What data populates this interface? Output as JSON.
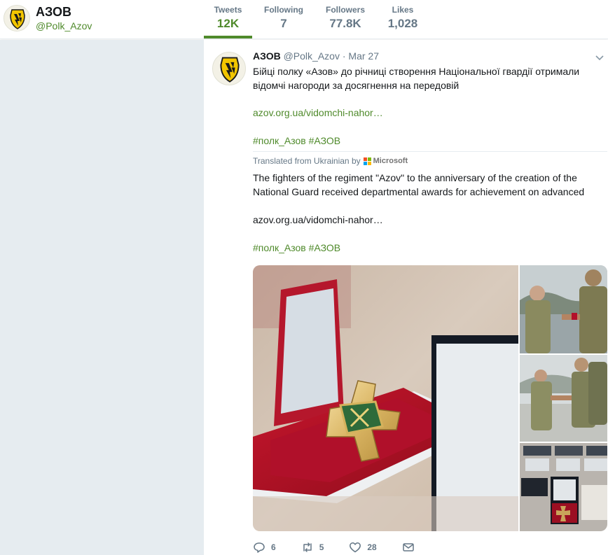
{
  "profile": {
    "name": "АЗОВ",
    "handle": "@Polk_Azov",
    "stats": [
      {
        "label": "Tweets",
        "value": "12K"
      },
      {
        "label": "Following",
        "value": "7"
      },
      {
        "label": "Followers",
        "value": "77.8K"
      },
      {
        "label": "Likes",
        "value": "1,028"
      }
    ]
  },
  "tweet": {
    "name": "АЗОВ",
    "handle": "@Polk_Azov",
    "separator": "·",
    "date": "Mar 27",
    "text_original": "Бійці полку «Азов» до річниці створення Національної гвардії отримали відомчі нагороди за досягнення на передовій",
    "link_original": "azov.org.ua/vidomchi-nahor…",
    "hashtags_original": "#полк_Азов #АЗОВ",
    "translated_label": "Translated from Ukrainian by",
    "translator": "Microsoft",
    "text_translated": "The fighters of the regiment \"Azov\" to the anniversary of the creation of the National Guard received departmental awards for achievement on advanced",
    "link_translated": "azov.org.ua/vidomchi-nahor…",
    "hashtags_translated": "#полк_Азов #АЗОВ",
    "actions": {
      "replies": "6",
      "retweets": "5",
      "likes": "28"
    }
  },
  "icons": [
    "chevron-down-icon",
    "reply-icon",
    "retweet-icon",
    "heart-icon",
    "envelope-icon",
    "microsoft-logo"
  ],
  "colors": {
    "accent": "#4f8a2b",
    "muted": "#657786",
    "background_gray": "#e6ecf0"
  }
}
